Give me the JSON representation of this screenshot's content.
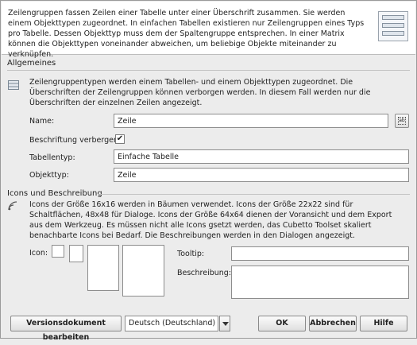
{
  "intro": {
    "text": "Zeilengruppen fassen Zeilen einer Tabelle unter einer Überschrift zusammen. Sie werden einem Objekttypen zugeordnet. In einfachen Tabellen existieren nur Zeilengruppen eines Typs pro Tabelle. Dessen Objekttyp muss dem der Spaltengruppe entsprechen. In einer Matrix können die Objekttypen voneinander abweichen, um beliebige Objekte miteinander zu verknüpfen.",
    "icon": "table-icon"
  },
  "general": {
    "title": "Allgemeines",
    "icon": "table-small-icon",
    "description": "Zeilengruppentypen werden einem Tabellen- und einem Objekttypen zugeordnet. Die Überschriften der Zeilengruppen können verborgen werden. In diesem Fall werden nur die Überschriften der einzelnen Zeilen angezeigt.",
    "name_label": "Name:",
    "name_value": "Zeile",
    "hide_label": "Beschriftung verbergen:",
    "hide_checked": "✔",
    "tabletype_label": "Tabellentyp:",
    "tabletype_value": "Einfache Tabelle",
    "objecttype_label": "Objekttyp:",
    "objecttype_value": "Zeile",
    "picker_icon": "text-picker-icon"
  },
  "icons": {
    "title": "Icons und Beschreibung",
    "icon": "signal-icon",
    "description": "Icons der Größe 16x16 werden in Bäumen verwendet. Icons der Größe 22x22 sind für Schaltflächen, 48x48 für Dialoge. Icons der Größe 64x64 dienen der Voransicht und dem Export aus dem Werkzeug. Es müssen nicht alle Icons gsetzt werden, das Cubetto Toolset skaliert benachbarte Icons bei Bedarf. Die Beschreibungen werden in den Dialogen angezeigt.",
    "icon_label": "Icon:",
    "tooltip_label": "Tooltip:",
    "tooltip_value": "",
    "desc_label": "Beschreibung:",
    "desc_value": ""
  },
  "footer": {
    "version_button": "Versionsdokument bearbeiten",
    "language": "Deutsch (Deutschland)",
    "ok": "OK",
    "cancel": "Abbrechen",
    "help": "Hilfe"
  }
}
